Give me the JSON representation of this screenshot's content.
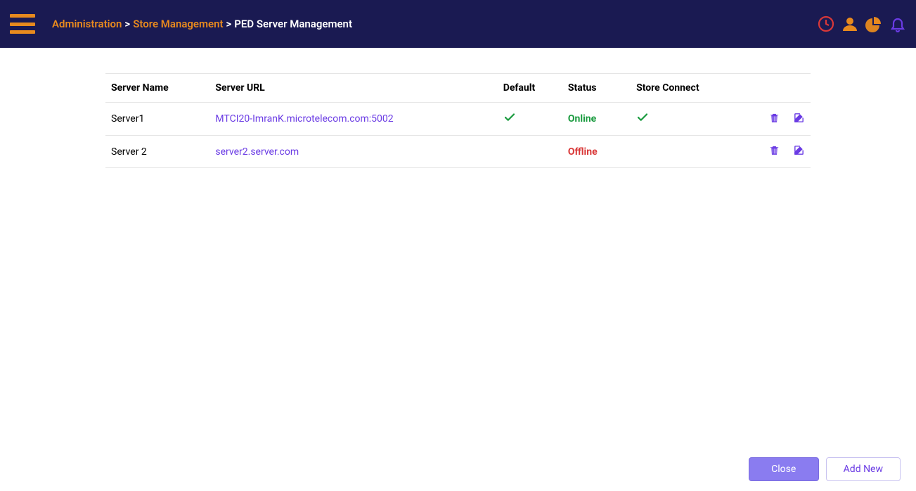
{
  "breadcrumb": {
    "items": [
      {
        "label": "Administration",
        "link": true
      },
      {
        "label": "Store Management",
        "link": true
      },
      {
        "label": "PED Server Management",
        "link": false
      }
    ]
  },
  "table": {
    "headers": {
      "name": "Server Name",
      "url": "Server URL",
      "default": "Default",
      "status": "Status",
      "connect": "Store Connect"
    },
    "rows": [
      {
        "name": "Server1",
        "url": "MTCI20-ImranK.microtelecom.com:5002",
        "default": true,
        "status": "Online",
        "status_class": "online",
        "connect": true
      },
      {
        "name": "Server 2",
        "url": "server2.server.com",
        "default": false,
        "status": "Offline",
        "status_class": "offline",
        "connect": false
      }
    ]
  },
  "buttons": {
    "close": "Close",
    "add": "Add New"
  }
}
